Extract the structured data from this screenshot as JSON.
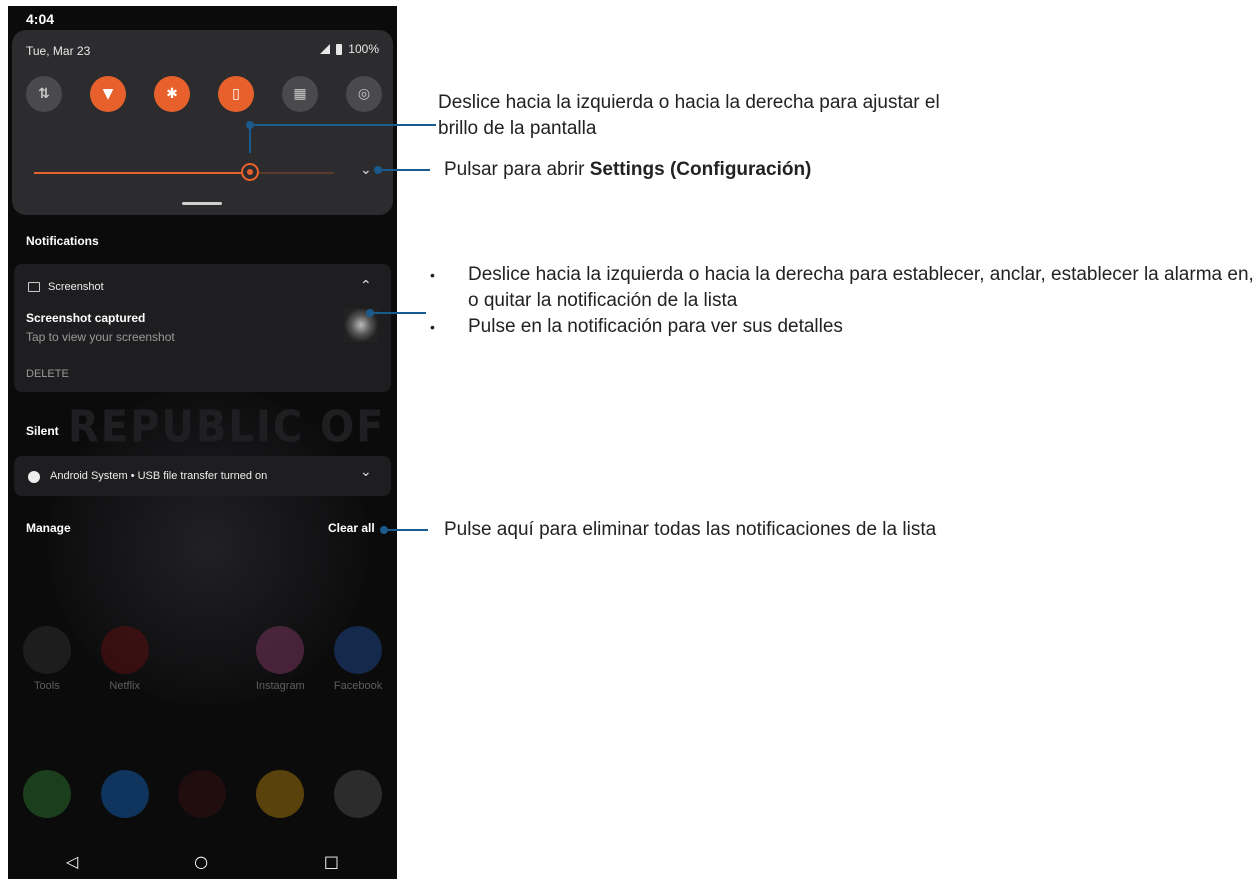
{
  "phone": {
    "time": "4:04",
    "quick_settings": {
      "date": "Tue, Mar 23",
      "battery": "100%",
      "tiles": [
        {
          "name": "data-icon",
          "glyph": "⇅",
          "on": false
        },
        {
          "name": "wifi-icon",
          "glyph": "▼",
          "on": true
        },
        {
          "name": "bluetooth-icon",
          "glyph": "✱",
          "on": true
        },
        {
          "name": "vibrate-icon",
          "glyph": "▯",
          "on": true
        },
        {
          "name": "qr-scan-icon",
          "glyph": "▦",
          "on": false
        },
        {
          "name": "hotspot-icon",
          "glyph": "◎",
          "on": false
        }
      ],
      "brightness": 0.72
    },
    "notifications_header": "Notifications",
    "screenshot_notif": {
      "app": "Screenshot",
      "title": "Screenshot captured",
      "body": "Tap to view your screenshot",
      "action": "DELETE"
    },
    "silent_header": "Silent",
    "system_notif": "Android System • USB file transfer turned on",
    "manage": "Manage",
    "clear_all": "Clear all",
    "apps_row1": [
      "Tools",
      "Netflix",
      "",
      "Instagram",
      "Facebook"
    ],
    "nav": {
      "back": "◁",
      "home": "○",
      "recents": "□"
    }
  },
  "callouts": {
    "brightness_l1": "Deslice hacia la izquierda o hacia la derecha para ajustar el",
    "brightness_l2": "brillo de la pantalla",
    "settings_pre": "Pulsar para abrir ",
    "settings_bold": "Settings (Configuración)",
    "notif_bullets": [
      "Deslice hacia la izquierda o hacia la derecha para establecer, anclar, establecer la alarma en, o quitar la notificación de la lista",
      "Pulse en la notificación para ver sus detalles"
    ],
    "clear": "Pulse aquí para eliminar todas las notificaciones de la lista"
  },
  "colors": {
    "accent": "#e8612c",
    "callout": "#1a5a8c"
  }
}
